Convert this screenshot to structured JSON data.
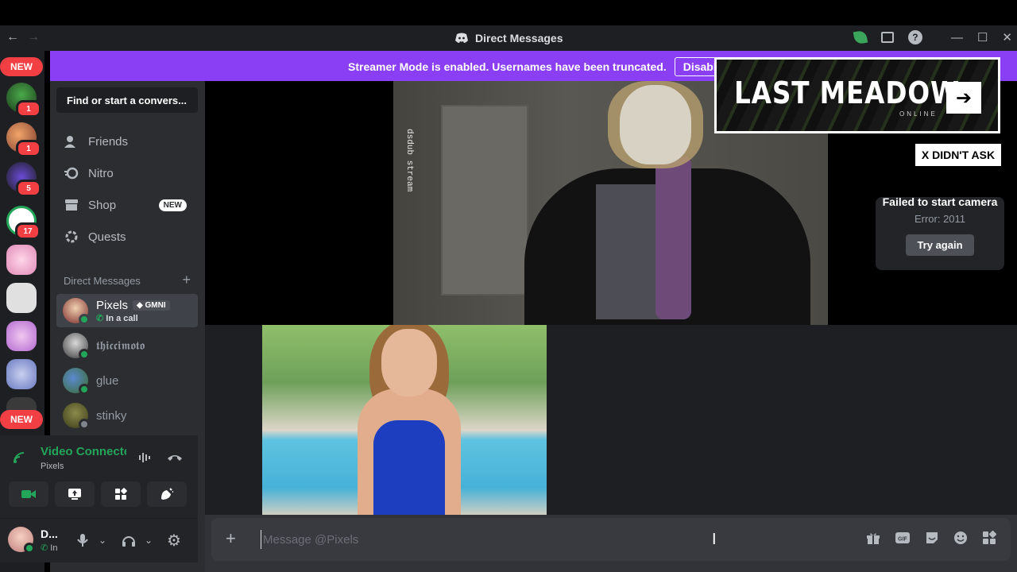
{
  "titlebar": {
    "title": "Direct Messages",
    "back_icon": "arrow-left",
    "forward_icon": "arrow-right"
  },
  "servers": {
    "new_top": "NEW",
    "new_bottom": "NEW",
    "badges": [
      "1",
      "1",
      "5",
      "17"
    ]
  },
  "banner": {
    "text": "Streamer Mode is enabled. Usernames have been truncated.",
    "button": "Disable"
  },
  "sidebar": {
    "search": "Find or start a convers...",
    "nav": [
      {
        "label": "Friends",
        "icon": "friends-icon"
      },
      {
        "label": "Nitro",
        "icon": "nitro-icon"
      },
      {
        "label": "Shop",
        "icon": "shop-icon",
        "badge": "NEW"
      },
      {
        "label": "Quests",
        "icon": "quests-icon"
      }
    ],
    "dm_header": "Direct Messages",
    "dm_add": "+",
    "dms": [
      {
        "name": "Pixels",
        "tag": "GMNI",
        "sub": "In a call",
        "status": "online"
      },
      {
        "name": "𝖙𝖍𝖎𝖈𝖈𝖎𝖒𝖔𝖙𝖔",
        "status": "online"
      },
      {
        "name": "glue",
        "status": "online"
      },
      {
        "name": "stinky",
        "status": "offline"
      }
    ]
  },
  "voice": {
    "title": "Video Connecte",
    "channel": "Pixels"
  },
  "user": {
    "name": "D...",
    "status": "In"
  },
  "stage": {
    "watermark": "dsdub stream",
    "error_title": "Failed to start camera",
    "error_code": "Error: 2011",
    "retry": "Try again"
  },
  "overlay": {
    "ad_title": "LAST MEADOW",
    "ad_sub": "ONLINE",
    "ad_arrow": "➔",
    "x_label": "X DIDN'T ASK"
  },
  "composer": {
    "placeholder": "Message @Pixels",
    "value": ""
  },
  "colors": {
    "blurple": "#8b3ff5",
    "green": "#23a55a",
    "red": "#f23f43"
  }
}
